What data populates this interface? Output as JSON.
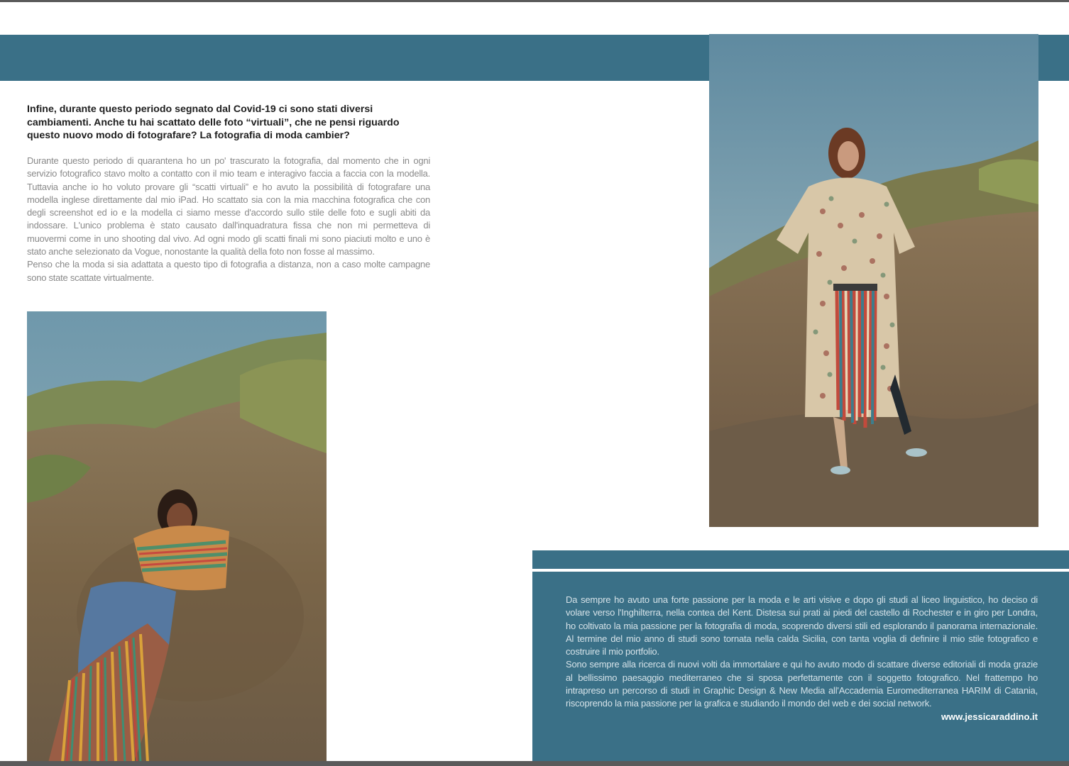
{
  "article": {
    "question": "Infine, durante questo periodo segnato dal Covid-19 ci sono stati diversi cambiamenti. Anche tu hai scattato delle foto “virtuali”, che ne pensi riguardo questo nuovo modo di fotografare? La fotografia di moda cambier?",
    "answer_p1": "Durante questo periodo di quarantena ho un po' trascurato la fotografia, dal momento che in ogni servizio fotografico stavo molto a contatto con il mio team e interagivo faccia a faccia con la modella. Tuttavia anche io ho voluto provare gli “scatti virtuali” e ho avuto la possibilità di fotografare una modella inglese direttamente dal mio iPad. Ho scattato sia con la mia macchina fotografica che con degli screenshot ed io e la modella ci siamo messe d'accordo sullo stile delle foto e sugli abiti da indossare. L'unico problema è stato causato dall'inquadratura fissa che non mi permetteva di muovermi come in uno shooting dal vivo. Ad ogni modo gli scatti finali mi sono piaciuti molto e uno è stato anche selezionato da Vogue, nonostante la qualità della foto non fosse al massimo.",
    "answer_p2": "Penso che la moda si sia adattata a questo tipo di fotografia a distanza, non a caso molte campagne sono state scattate virtualmente."
  },
  "bio": {
    "p1": "Da sempre ho avuto una forte passione per la moda e le arti visive e dopo gli studi al liceo linguistico, ho deciso di volare verso l'Inghilterra, nella contea del Kent. Distesa sui prati ai piedi del castello di Rochester e in giro per Londra, ho coltivato la mia passione per la fotografia di moda, scoprendo diversi stili ed esplorando il panorama internazionale. Al termine del mio anno di studi sono tornata nella calda Sicilia, con tanta voglia di definire il mio stile fotografico e costruire il mio portfolio.",
    "p2": "Sono sempre alla ricerca di nuovi volti da immortalare e qui ho avuto modo di scattare diverse editoriali di moda grazie al bellissimo paesaggio mediterraneo che si sposa perfettamente con il soggetto fotografico. Nel frattempo ho intrapreso un percorso di studi in Graphic Design & New Media all'Accademia  Euromediterranea HARIM di Catania, riscoprendo la mia passione per la grafica e studiando il mondo del web e dei social network.",
    "website": "www.jessicaraddino.it"
  },
  "colors": {
    "accent_band": "#3a7087",
    "heading_text": "#1e1e1e",
    "body_text": "#8a8a8a",
    "bio_text": "#d5e2e8"
  }
}
